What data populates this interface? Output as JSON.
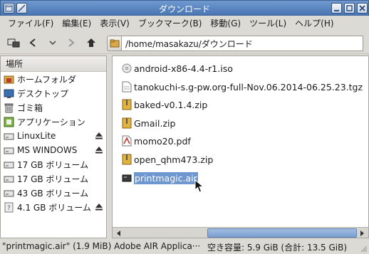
{
  "window": {
    "title": "ダウンロード"
  },
  "menu": [
    {
      "label": "ファイル(F)"
    },
    {
      "label": "編集(E)"
    },
    {
      "label": "表示(V)"
    },
    {
      "label": "ブックマーク(B)"
    },
    {
      "label": "移動(G)"
    },
    {
      "label": "ツール(L)"
    },
    {
      "label": "ヘルプ(H)"
    }
  ],
  "location": {
    "path": "/home/masakazu/ダウンロード"
  },
  "sidebar": {
    "header": "場所",
    "items": [
      {
        "label": "ホームフォルダ",
        "icon": "home-folder-icon"
      },
      {
        "label": "デスクトップ",
        "icon": "desktop-icon"
      },
      {
        "label": "ゴミ箱",
        "icon": "trash-icon"
      },
      {
        "label": "アプリケーション",
        "icon": "applications-icon"
      },
      {
        "label": "LinuxLite",
        "icon": "drive-icon",
        "eject": true
      },
      {
        "label": "MS WINDOWS",
        "icon": "drive-icon",
        "eject": true
      },
      {
        "label": "17 GB ボリューム",
        "icon": "drive-icon"
      },
      {
        "label": "17 GB ボリューム",
        "icon": "drive-icon"
      },
      {
        "label": "43 GB ボリューム",
        "icon": "drive-icon"
      },
      {
        "label": "4.1 GB ボリューム",
        "icon": "unknown-drive-icon",
        "eject": true
      }
    ]
  },
  "files": [
    {
      "name": "android-x86-4.4-r1.iso",
      "icon": "disc-image-icon"
    },
    {
      "name": "tanokuchi-s.g-pw.org-full-Nov.06.2014-06.25.23.tgz",
      "icon": "document-icon"
    },
    {
      "name": "baked-v0.1.4.zip",
      "icon": "archive-icon"
    },
    {
      "name": "Gmail.zip",
      "icon": "archive-icon"
    },
    {
      "name": "momo20.pdf",
      "icon": "pdf-icon"
    },
    {
      "name": "open_qhm473.zip",
      "icon": "archive-icon"
    },
    {
      "name": "printmagic.air",
      "icon": "air-package-icon",
      "selected": true
    }
  ],
  "status": {
    "selection": "\"printmagic.air\" (1.9 MiB) Adobe AIR Applica···",
    "free_space": "空き容量: 5.9 GiB (合計: 13.5 GiB)"
  },
  "colors": {
    "titlebar": "#4a76b3",
    "selection": "#6e96cf"
  }
}
